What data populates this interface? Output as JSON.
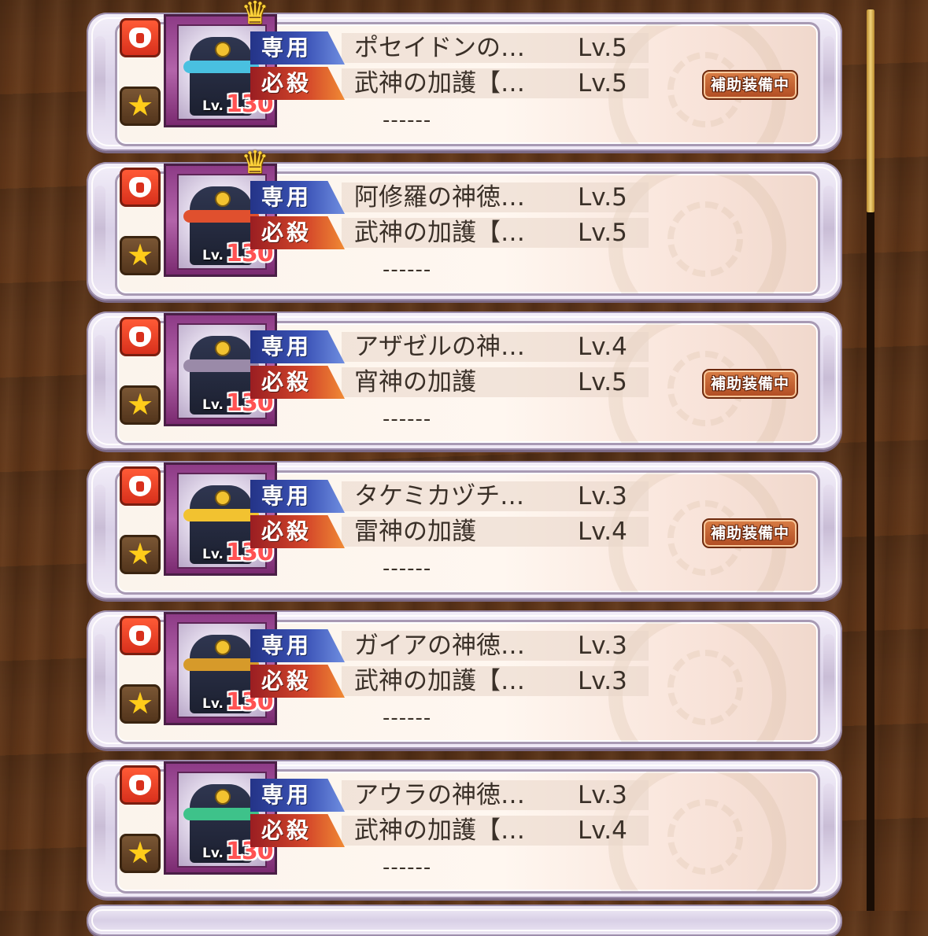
{
  "list": {
    "items": [
      {
        "level_label": "Lv.",
        "level": "130",
        "crown": true,
        "exclusive_tag": "専用",
        "exclusive_name": "ポセイドンの…",
        "exclusive_level": "Lv.5",
        "special_tag": "必殺",
        "special_name": "武神の加護【…",
        "special_level": "Lv.5",
        "empty_slot": "------",
        "badge": "補助装備中",
        "band_color": "#49c0e0"
      },
      {
        "level_label": "Lv.",
        "level": "130",
        "crown": true,
        "exclusive_tag": "専用",
        "exclusive_name": "阿修羅の神徳…",
        "exclusive_level": "Lv.5",
        "special_tag": "必殺",
        "special_name": "武神の加護【…",
        "special_level": "Lv.5",
        "empty_slot": "------",
        "badge": "",
        "band_color": "#e0502e"
      },
      {
        "level_label": "Lv.",
        "level": "130",
        "crown": false,
        "exclusive_tag": "専用",
        "exclusive_name": "アザゼルの神…",
        "exclusive_level": "Lv.4",
        "special_tag": "必殺",
        "special_name": "宵神の加護",
        "special_level": "Lv.5",
        "empty_slot": "------",
        "badge": "補助装備中",
        "band_color": "#9a8aa8"
      },
      {
        "level_label": "Lv.",
        "level": "130",
        "crown": false,
        "exclusive_tag": "専用",
        "exclusive_name": "タケミカヅチ…",
        "exclusive_level": "Lv.3",
        "special_tag": "必殺",
        "special_name": "雷神の加護",
        "special_level": "Lv.4",
        "empty_slot": "------",
        "badge": "補助装備中",
        "band_color": "#f2c230"
      },
      {
        "level_label": "Lv.",
        "level": "130",
        "crown": false,
        "exclusive_tag": "専用",
        "exclusive_name": "ガイアの神徳…",
        "exclusive_level": "Lv.3",
        "special_tag": "必殺",
        "special_name": "武神の加護【…",
        "special_level": "Lv.3",
        "empty_slot": "------",
        "badge": "",
        "band_color": "#d69a2a"
      },
      {
        "level_label": "Lv.",
        "level": "130",
        "crown": false,
        "exclusive_tag": "専用",
        "exclusive_name": "アウラの神徳…",
        "exclusive_level": "Lv.3",
        "special_tag": "必殺",
        "special_name": "武神の加護【…",
        "special_level": "Lv.4",
        "empty_slot": "------",
        "badge": "",
        "band_color": "#3ec28a"
      }
    ]
  },
  "icons": {
    "armor_button": "armor-icon",
    "favorite_button": "star-icon",
    "crown": "crown-icon"
  },
  "colors": {
    "exclusive_tag": "#3d55b8",
    "special_tag": "#d4472a",
    "badge": "#b04b22",
    "level_number": "#ff5252",
    "scroll_thumb": "#f1d27a"
  }
}
